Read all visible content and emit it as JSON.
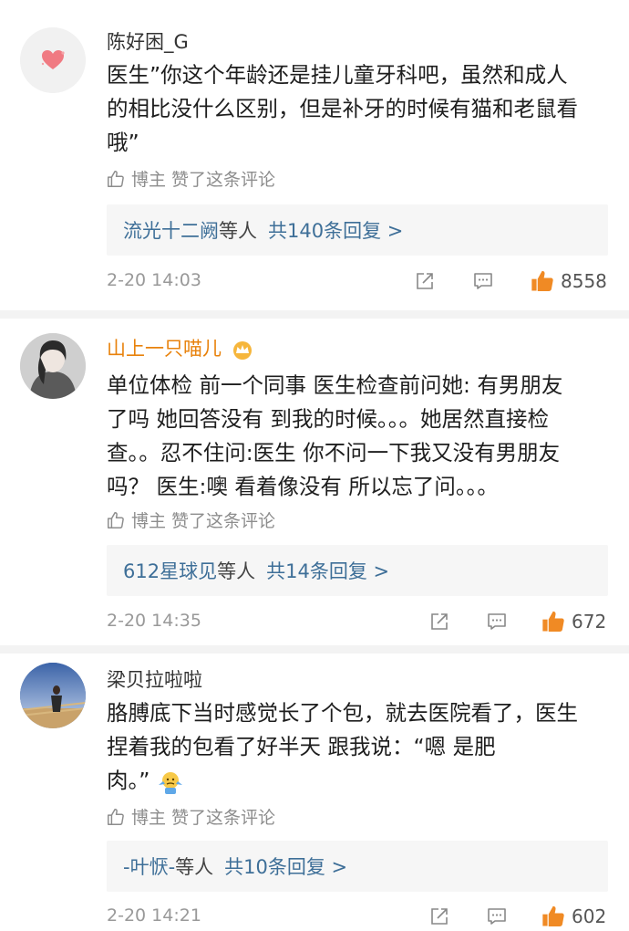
{
  "comments": [
    {
      "username": "陈好困_G",
      "lines": [
        "医生”你这个年龄还是挂儿童牙科吧，虽然和成人",
        "的相比没什么区别，但是补牙的时候有猫和老鼠看",
        "哦”"
      ],
      "liked_by_author": "博主 赞了这条评论",
      "reply_names": "流光十二阙",
      "reply_mid": "等人",
      "reply_count": "共140条回复 >",
      "time": "2-20 14:03",
      "likes": "8558"
    },
    {
      "username": "山上一只喵儿",
      "lines": [
        "单位体检 前一个同事 医生检查前问她: 有男朋友",
        "了吗 她回答没有 到我的时候。。。她居然直接检",
        "查。。忍不住问:医生 你不问一下我又没有男朋友",
        "吗？ 医生:噢 看着像没有 所以忘了问。。。"
      ],
      "liked_by_author": "博主 赞了这条评论",
      "reply_names": "612星球见",
      "reply_mid": "等人",
      "reply_count": "共14条回复 >",
      "time": "2-20 14:35",
      "likes": "672"
    },
    {
      "username": "梁贝拉啦啦",
      "lines": [
        "胳膊底下当时感觉长了个包，就去医院看了，医生",
        "捏着我的包看了好半天 跟我说：“嗯 是肥",
        "肉。”"
      ],
      "liked_by_author": "博主 赞了这条评论",
      "reply_names": "-叶恹-",
      "reply_mid": "等人",
      "reply_count": "共10条回复 >",
      "time": "2-20 14:21",
      "likes": "602"
    }
  ],
  "colors": {
    "link": "#3e6f98",
    "meta": "#999999",
    "accent_orange": "#f08a24",
    "username_orange": "#e8820c"
  },
  "icons": [
    "heart-avatar-icon",
    "thumb-up-outline-icon",
    "share-icon",
    "comment-icon",
    "thumb-up-filled-icon",
    "vip-crown-icon",
    "shrug-emoji-icon"
  ]
}
